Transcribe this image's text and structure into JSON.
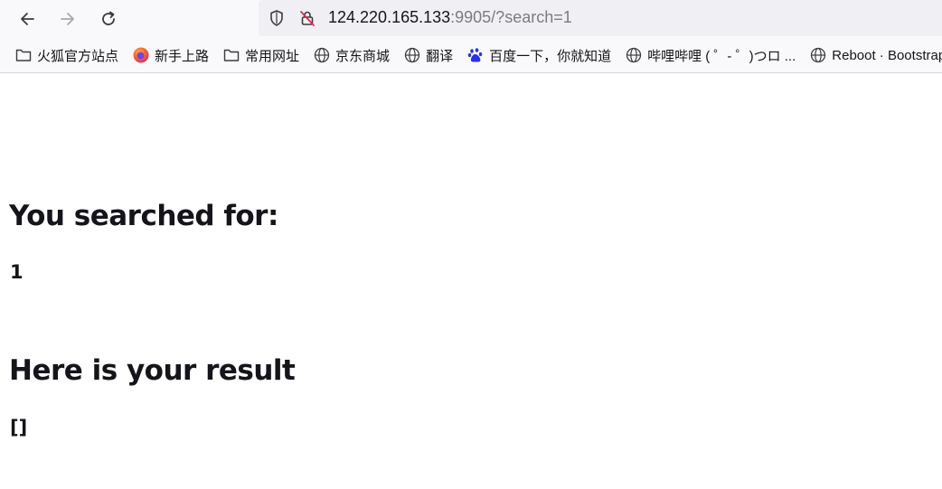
{
  "browser": {
    "url_host": "124.220.165.133",
    "url_rest": ":9905/?search=1"
  },
  "bookmarks": [
    {
      "label": "火狐官方站点",
      "icon": "folder-icon"
    },
    {
      "label": "新手上路",
      "icon": "firefox-icon"
    },
    {
      "label": "常用网址",
      "icon": "folder-icon"
    },
    {
      "label": "京东商城",
      "icon": "globe-icon"
    },
    {
      "label": "翻译",
      "icon": "globe-icon"
    },
    {
      "label": "百度一下，你就知道",
      "icon": "baidu-paw-icon"
    },
    {
      "label": "哔哩哔哩 ( ゜- ゜)つロ ...",
      "icon": "globe-icon"
    },
    {
      "label": "Reboot · Bootstrap",
      "icon": "globe-icon"
    }
  ],
  "page": {
    "search_heading": "You searched for:",
    "search_value": "1",
    "result_heading": "Here is your result",
    "result_value": "[]"
  }
}
